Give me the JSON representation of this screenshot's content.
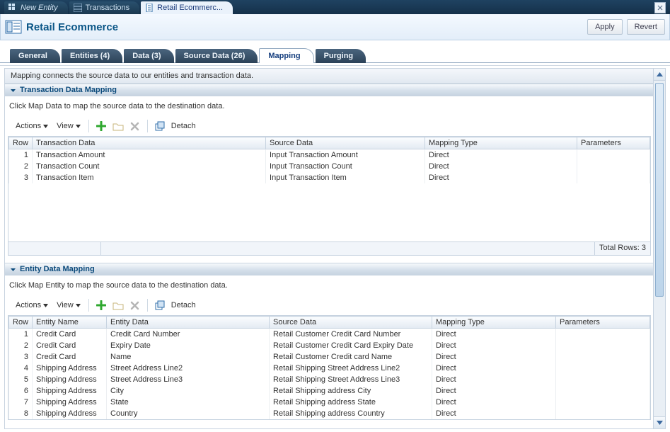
{
  "topTabs": [
    {
      "label": "New Entity",
      "active": false,
      "italic": true
    },
    {
      "label": "Transactions",
      "active": false,
      "italic": false
    },
    {
      "label": "Retail Ecommerc...",
      "active": true,
      "italic": false
    }
  ],
  "header": {
    "title": "Retail Ecommerce",
    "apply": "Apply",
    "revert": "Revert"
  },
  "midTabs": [
    "General",
    "Entities (4)",
    "Data (3)",
    "Source Data (26)",
    "Mapping",
    "Purging"
  ],
  "midActive": "Mapping",
  "infoStrip": "Mapping connects the source data to our entities and transaction data.",
  "common": {
    "actions": "Actions",
    "view": "View",
    "detach": "Detach",
    "row": "Row"
  },
  "transactionMapping": {
    "title": "Transaction Data Mapping",
    "hint": "Click Map Data to map the source data to the destination data.",
    "columns": [
      "Transaction Data",
      "Source Data",
      "Mapping Type",
      "Parameters"
    ],
    "rows": [
      {
        "n": "1",
        "td": "Transaction Amount",
        "sd": "Input Transaction Amount",
        "mt": "Direct",
        "p": ""
      },
      {
        "n": "2",
        "td": "Transaction Count",
        "sd": "Input Transaction Count",
        "mt": "Direct",
        "p": ""
      },
      {
        "n": "3",
        "td": "Transaction Item",
        "sd": "Input Transaction Item",
        "mt": "Direct",
        "p": ""
      }
    ],
    "footer": "Total Rows: 3"
  },
  "entityMapping": {
    "title": "Entity Data Mapping",
    "hint": "Click Map Entity to map the source data to the destination data.",
    "columns": [
      "Entity Name",
      "Entity Data",
      "Source Data",
      "Mapping Type",
      "Parameters"
    ],
    "rows": [
      {
        "n": "1",
        "en": "Credit Card",
        "ed": "Credit Card Number",
        "sd": "Retail Customer Credit Card Number",
        "mt": "Direct",
        "p": ""
      },
      {
        "n": "2",
        "en": "Credit Card",
        "ed": "Expiry Date",
        "sd": "Retail Customer Credit Card Expiry Date",
        "mt": "Direct",
        "p": ""
      },
      {
        "n": "3",
        "en": "Credit Card",
        "ed": "Name",
        "sd": "Retail Customer Credit card Name",
        "mt": "Direct",
        "p": ""
      },
      {
        "n": "4",
        "en": "Shipping Address",
        "ed": "Street Address Line2",
        "sd": "Retail Shipping Street Address Line2",
        "mt": "Direct",
        "p": ""
      },
      {
        "n": "5",
        "en": "Shipping Address",
        "ed": "Street Address Line3",
        "sd": "Retail Shipping Street Address Line3",
        "mt": "Direct",
        "p": ""
      },
      {
        "n": "6",
        "en": "Shipping Address",
        "ed": "City",
        "sd": "Retail Shipping address City",
        "mt": "Direct",
        "p": ""
      },
      {
        "n": "7",
        "en": "Shipping Address",
        "ed": "State",
        "sd": "Retail Shipping address State",
        "mt": "Direct",
        "p": ""
      },
      {
        "n": "8",
        "en": "Shipping Address",
        "ed": "Country",
        "sd": "Retail Shipping address Country",
        "mt": "Direct",
        "p": ""
      }
    ]
  }
}
